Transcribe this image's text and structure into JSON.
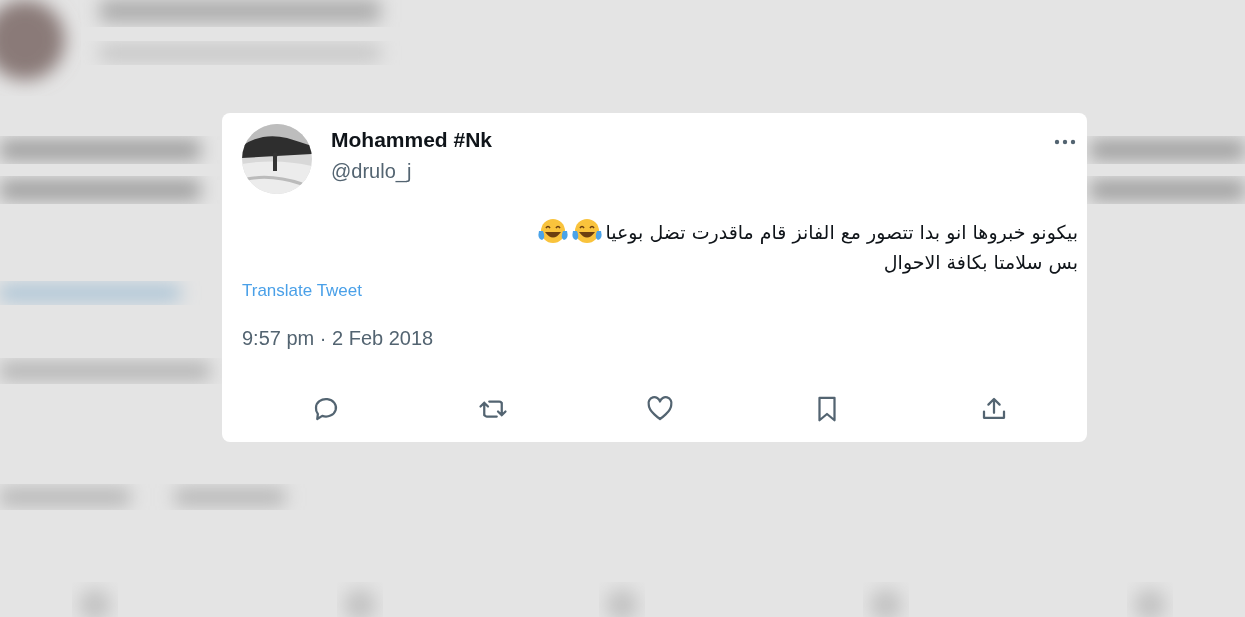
{
  "tweet": {
    "author": {
      "name": "Mohammed #Nk",
      "handle": "@drulo_j"
    },
    "lines": [
      {
        "text": "بيكونو خبروها انو بدا تتصور مع الفانز قام ماقدرت تضل بوعيا",
        "emoji": [
          {
            "kind": "tears_of_joy"
          },
          {
            "kind": "tears_of_joy"
          }
        ]
      },
      {
        "text": "بس سلامتا بكافة الاحوال"
      }
    ],
    "translate": "Translate Tweet",
    "timestamp": "9:57 pm · 2 Feb 2018",
    "actions": [
      {
        "kind": "reply"
      },
      {
        "kind": "retweet"
      },
      {
        "kind": "like"
      },
      {
        "kind": "bookmark"
      },
      {
        "kind": "share"
      }
    ]
  }
}
